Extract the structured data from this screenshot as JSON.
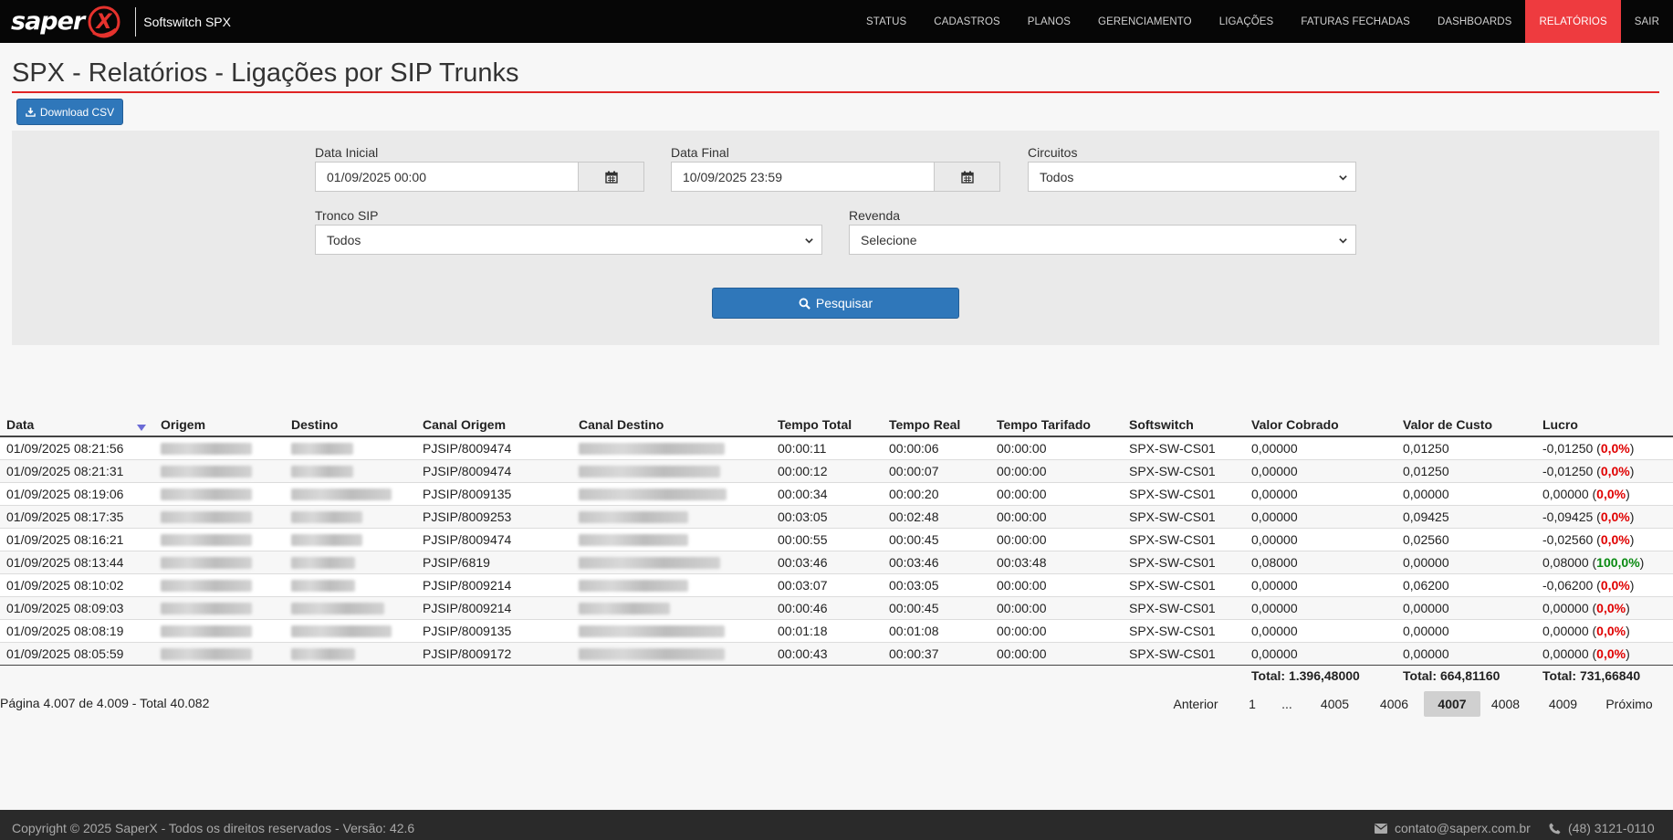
{
  "brand": {
    "logo_text": "saper",
    "logo_mark": "X",
    "app_name": "Softswitch SPX"
  },
  "nav": [
    {
      "label": "STATUS"
    },
    {
      "label": "CADASTROS"
    },
    {
      "label": "PLANOS"
    },
    {
      "label": "GERENCIAMENTO"
    },
    {
      "label": "LIGAÇÕES"
    },
    {
      "label": "FATURAS FECHADAS"
    },
    {
      "label": "DASHBOARDS"
    },
    {
      "label": "RELATÓRIOS",
      "active": true
    },
    {
      "label": "SAIR"
    }
  ],
  "page": {
    "title": "SPX - Relatórios - Ligações por SIP Trunks",
    "download_label": "Download CSV"
  },
  "filters": {
    "data_inicial": {
      "label": "Data Inicial",
      "value": "01/09/2025 00:00"
    },
    "data_final": {
      "label": "Data Final",
      "value": "10/09/2025 23:59"
    },
    "circuitos": {
      "label": "Circuitos",
      "value": "Todos"
    },
    "tronco": {
      "label": "Tronco SIP",
      "value": "Todos"
    },
    "revenda": {
      "label": "Revenda",
      "value": "Selecione"
    },
    "search_label": "Pesquisar"
  },
  "table": {
    "columns": [
      "Data",
      "Origem",
      "Destino",
      "Canal Origem",
      "Canal Destino",
      "Tempo Total",
      "Tempo Real",
      "Tempo Tarifado",
      "Softswitch",
      "Valor Cobrado",
      "Valor de Custo",
      "Lucro"
    ],
    "rows": [
      {
        "data": "01/09/2025 08:21:56",
        "canal_origem": "PJSIP/8009474",
        "tempo_total": "00:00:11",
        "tempo_real": "00:00:06",
        "tempo_tarifado": "00:00:00",
        "softswitch": "SPX-SW-CS01",
        "valor_cobrado": "0,00000",
        "valor_custo": "0,01250",
        "lucro": "-0,01250",
        "lucro_pct": "0,0%",
        "pct_color": "neg"
      },
      {
        "data": "01/09/2025 08:21:31",
        "canal_origem": "PJSIP/8009474",
        "tempo_total": "00:00:12",
        "tempo_real": "00:00:07",
        "tempo_tarifado": "00:00:00",
        "softswitch": "SPX-SW-CS01",
        "valor_cobrado": "0,00000",
        "valor_custo": "0,01250",
        "lucro": "-0,01250",
        "lucro_pct": "0,0%",
        "pct_color": "neg"
      },
      {
        "data": "01/09/2025 08:19:06",
        "canal_origem": "PJSIP/8009135",
        "tempo_total": "00:00:34",
        "tempo_real": "00:00:20",
        "tempo_tarifado": "00:00:00",
        "softswitch": "SPX-SW-CS01",
        "valor_cobrado": "0,00000",
        "valor_custo": "0,00000",
        "lucro": "0,00000",
        "lucro_pct": "0,0%",
        "pct_color": "neg"
      },
      {
        "data": "01/09/2025 08:17:35",
        "canal_origem": "PJSIP/8009253",
        "tempo_total": "00:03:05",
        "tempo_real": "00:02:48",
        "tempo_tarifado": "00:00:00",
        "softswitch": "SPX-SW-CS01",
        "valor_cobrado": "0,00000",
        "valor_custo": "0,09425",
        "lucro": "-0,09425",
        "lucro_pct": "0,0%",
        "pct_color": "neg"
      },
      {
        "data": "01/09/2025 08:16:21",
        "canal_origem": "PJSIP/8009474",
        "tempo_total": "00:00:55",
        "tempo_real": "00:00:45",
        "tempo_tarifado": "00:00:00",
        "softswitch": "SPX-SW-CS01",
        "valor_cobrado": "0,00000",
        "valor_custo": "0,02560",
        "lucro": "-0,02560",
        "lucro_pct": "0,0%",
        "pct_color": "neg"
      },
      {
        "data": "01/09/2025 08:13:44",
        "canal_origem": "PJSIP/6819",
        "tempo_total": "00:03:46",
        "tempo_real": "00:03:46",
        "tempo_tarifado": "00:03:48",
        "softswitch": "SPX-SW-CS01",
        "valor_cobrado": "0,08000",
        "valor_custo": "0,00000",
        "lucro": "0,08000",
        "lucro_pct": "100,0%",
        "pct_color": "pos"
      },
      {
        "data": "01/09/2025 08:10:02",
        "canal_origem": "PJSIP/8009214",
        "tempo_total": "00:03:07",
        "tempo_real": "00:03:05",
        "tempo_tarifado": "00:00:00",
        "softswitch": "SPX-SW-CS01",
        "valor_cobrado": "0,00000",
        "valor_custo": "0,06200",
        "lucro": "-0,06200",
        "lucro_pct": "0,0%",
        "pct_color": "neg"
      },
      {
        "data": "01/09/2025 08:09:03",
        "canal_origem": "PJSIP/8009214",
        "tempo_total": "00:00:46",
        "tempo_real": "00:00:45",
        "tempo_tarifado": "00:00:00",
        "softswitch": "SPX-SW-CS01",
        "valor_cobrado": "0,00000",
        "valor_custo": "0,00000",
        "lucro": "0,00000",
        "lucro_pct": "0,0%",
        "pct_color": "neg"
      },
      {
        "data": "01/09/2025 08:08:19",
        "canal_origem": "PJSIP/8009135",
        "tempo_total": "00:01:18",
        "tempo_real": "00:01:08",
        "tempo_tarifado": "00:00:00",
        "softswitch": "SPX-SW-CS01",
        "valor_cobrado": "0,00000",
        "valor_custo": "0,00000",
        "lucro": "0,00000",
        "lucro_pct": "0,0%",
        "pct_color": "neg"
      },
      {
        "data": "01/09/2025 08:05:59",
        "canal_origem": "PJSIP/8009172",
        "tempo_total": "00:00:43",
        "tempo_real": "00:00:37",
        "tempo_tarifado": "00:00:00",
        "softswitch": "SPX-SW-CS01",
        "valor_cobrado": "0,00000",
        "valor_custo": "0,00000",
        "lucro": "0,00000",
        "lucro_pct": "0,0%",
        "pct_color": "neg"
      }
    ],
    "totals": {
      "valor_cobrado": "Total: 1.396,48000",
      "valor_custo": "Total: 664,81160",
      "lucro": "Total: 731,66840"
    }
  },
  "pagination": {
    "info": "Página 4.007 de 4.009 - Total 40.082",
    "items": [
      {
        "label": "Anterior"
      },
      {
        "label": "1"
      },
      {
        "label": "..."
      },
      {
        "label": "4005"
      },
      {
        "label": "4006"
      },
      {
        "label": "4007",
        "current": true
      },
      {
        "label": "4008"
      },
      {
        "label": "4009"
      },
      {
        "label": "Próximo"
      }
    ]
  },
  "footer": {
    "copyright": "Copyright © 2025 SaperX - Todos os direitos reservados - Versão: 42.6",
    "email": "contato@saperx.com.br",
    "phone": "(48) 3121-0110"
  },
  "colors": {
    "navbar": "#060606",
    "active_nav": "#ee3b3f",
    "primary_button": "#2f77ba",
    "title_rule": "#e02424",
    "negative": "#e00000",
    "positive": "#0a8a12"
  },
  "icons": [
    "download-icon",
    "calendar-icon",
    "chevron-down-icon",
    "search-icon",
    "sort-desc-icon",
    "envelope-icon",
    "phone-icon"
  ]
}
